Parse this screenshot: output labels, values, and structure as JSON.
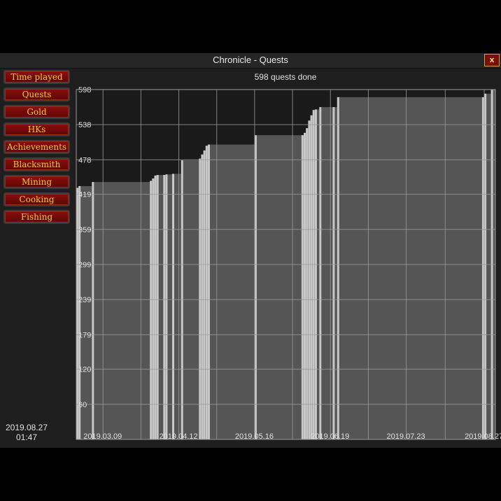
{
  "window": {
    "title": "Chronicle - Quests",
    "close_label": "x"
  },
  "sidebar": {
    "items": [
      {
        "label": "Time played"
      },
      {
        "label": "Quests"
      },
      {
        "label": "Gold"
      },
      {
        "label": "HKs"
      },
      {
        "label": "Achievements"
      },
      {
        "label": "Blacksmith"
      },
      {
        "label": "Mining"
      },
      {
        "label": "Cooking"
      },
      {
        "label": "Fishing"
      }
    ]
  },
  "datetime": {
    "date": "2019.08.27",
    "time": "01:47"
  },
  "colors": {
    "bar": "#555555",
    "bar_highlight": "#c8c8c8",
    "grid": "#9a9a9a",
    "close_button": "#7a0c0c",
    "button_text": "#f0c828"
  },
  "chart_data": {
    "type": "area",
    "title": "598 quests done",
    "xlabel": "",
    "ylabel": "",
    "ylim": [
      0,
      598
    ],
    "y_ticks": [
      "60",
      "120",
      "179",
      "239",
      "299",
      "359",
      "419",
      "478",
      "538",
      "598"
    ],
    "x_tick_labels": [
      "2019.03.09",
      "2019.04.12",
      "2019.05.16",
      "2019.06.19",
      "2019.07.23",
      "2019.08.27"
    ],
    "xlim": [
      "2019.02.25",
      "2019.09.01"
    ],
    "grid": true,
    "series": [
      {
        "x": [
          "2019.02.25",
          "2019.02.26",
          "2019.03.04",
          "2019.03.30",
          "2019.03.31",
          "2019.04.01",
          "2019.04.02",
          "2019.04.05",
          "2019.04.06",
          "2019.04.09",
          "2019.04.13",
          "2019.04.21",
          "2019.04.22",
          "2019.04.23",
          "2019.04.24",
          "2019.04.25",
          "2019.05.16",
          "2019.06.06",
          "2019.06.07",
          "2019.06.08",
          "2019.06.09",
          "2019.06.10",
          "2019.06.11",
          "2019.06.12",
          "2019.06.14",
          "2019.06.20",
          "2019.06.22",
          "2019.08.26",
          "2019.08.27",
          "2019.08.30"
        ],
        "y": [
          430,
          433,
          440,
          442,
          446,
          451,
          452,
          452,
          453,
          454,
          477,
          480,
          487,
          494,
          502,
          504,
          520,
          520,
          524,
          532,
          545,
          554,
          563,
          564,
          568,
          568,
          585,
          585,
          591,
          598
        ]
      }
    ]
  }
}
